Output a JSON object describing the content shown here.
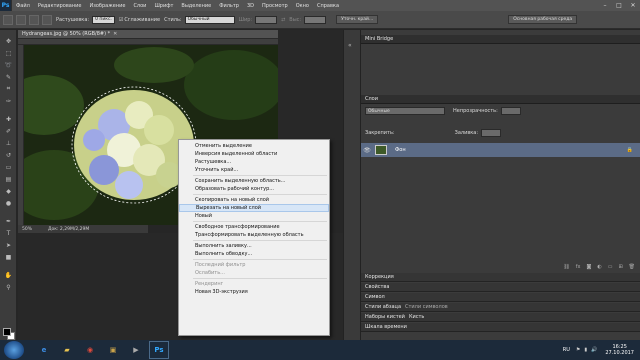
{
  "app": {
    "logo": "Ps"
  },
  "menubar": {
    "items": [
      "Файл",
      "Редактирование",
      "Изображение",
      "Слои",
      "Шрифт",
      "Выделение",
      "Фильтр",
      "3D",
      "Просмотр",
      "Окно",
      "Справка"
    ]
  },
  "options": {
    "feather_label": "Растушевка:",
    "feather_value": "0 пикс.",
    "antialias_label": "Сглаживание",
    "style_label": "Стиль:",
    "style_value": "Обычный",
    "width_label": "Шир:",
    "height_label": "Выс:",
    "refine_edge_button": "Уточн. край...",
    "workspace_value": "Основная рабочая среда"
  },
  "document": {
    "tab_title": "Hydrangeas.jpg @ 50% (RGB/8#) *",
    "zoom": "50%",
    "doc_size": "Док: 2,29M/2,29M"
  },
  "panels": {
    "mini_bridge": "Mini Bridge",
    "layers_title": "Слои",
    "blend_mode": "Обычные",
    "opacity_label": "Непрозрачность:",
    "lock_label": "Закрепить:",
    "fill_label": "Заливка:",
    "layer_name": "Фон",
    "stack_tabs": [
      "Коррекция",
      "Свойства",
      "Символ",
      "Стили абзаца",
      "Наборы кистей",
      "Шкала времени"
    ],
    "stack_tabs_right": [
      "Стили символов",
      "Кисть"
    ]
  },
  "context_menu": {
    "items": [
      {
        "label": "Отменить выделение",
        "disabled": false
      },
      {
        "label": "Инверсия выделенной области",
        "disabled": false
      },
      {
        "label": "Растушевка...",
        "disabled": false
      },
      {
        "label": "Уточнить край...",
        "disabled": false
      },
      {
        "sep": true
      },
      {
        "label": "Сохранить выделенную область...",
        "disabled": false
      },
      {
        "label": "Образовать рабочий контур...",
        "disabled": false
      },
      {
        "sep": true
      },
      {
        "label": "Скопировать на новый слой",
        "disabled": false
      },
      {
        "label": "Вырезать на новый слой",
        "disabled": false,
        "hover": true
      },
      {
        "label": "Новый",
        "disabled": false
      },
      {
        "sep": true
      },
      {
        "label": "Свободное трансформирование",
        "disabled": false
      },
      {
        "label": "Трансформировать выделенную область",
        "disabled": false
      },
      {
        "sep": true
      },
      {
        "label": "Выполнить заливку...",
        "disabled": false
      },
      {
        "label": "Выполнить обводку...",
        "disabled": false
      },
      {
        "sep": true
      },
      {
        "label": "Последний фильтр",
        "disabled": true
      },
      {
        "label": "Ослабить...",
        "disabled": true
      },
      {
        "sep": true
      },
      {
        "label": "Рендеринг",
        "disabled": true
      },
      {
        "label": "Новая 3D-экструзия",
        "disabled": false
      }
    ]
  },
  "taskbar": {
    "lang": "RU",
    "time": "16:25",
    "date": "27.10.2017"
  },
  "colors": {
    "accent": "#31a8ff",
    "layer_selected": "#5b6b86",
    "menu_hover": "#d7e6f7"
  }
}
